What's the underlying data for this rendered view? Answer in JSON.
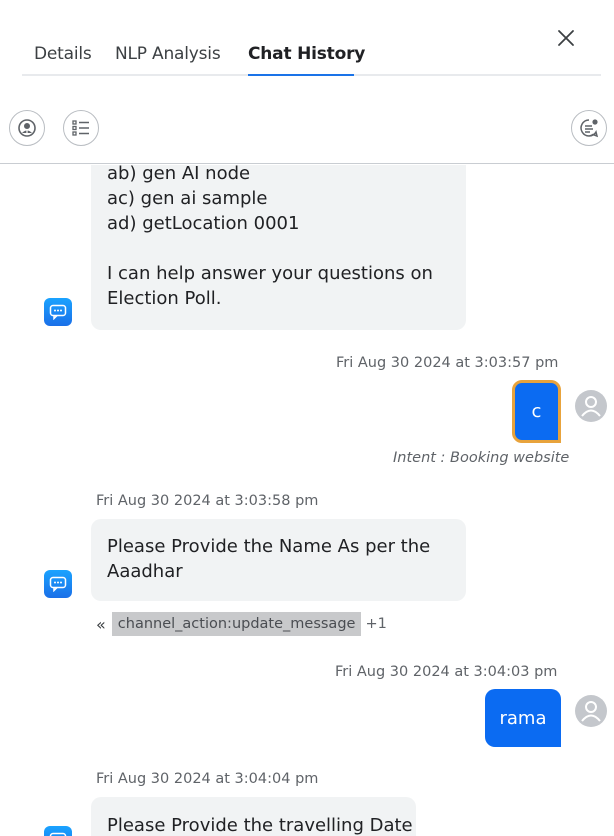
{
  "tabs": [
    {
      "label": "Details"
    },
    {
      "label": "NLP Analysis"
    },
    {
      "label": "Chat History"
    }
  ],
  "active_tab": "Chat History",
  "icons": {
    "close": "close-icon",
    "toolbar_left_1": "user-circle-icon",
    "toolbar_left_2": "list-icon",
    "toolbar_right": "chat-notification-icon",
    "bot": "bot-chat-icon",
    "user": "user-avatar-icon"
  },
  "colors": {
    "accent": "#1a73e8",
    "user_bubble": "#0b6bf2",
    "focus_outline": "#e8a33c",
    "bot_bubble": "#f1f3f4"
  },
  "messages": {
    "bot_1": {
      "lines": [
        "ab) gen AI node",
        "ac) gen ai sample",
        "ad) getLocation 0001",
        "",
        "I can help answer your questions on",
        "Election Poll."
      ]
    },
    "user_1": {
      "timestamp": "Fri Aug 30 2024 at 3:03:57 pm",
      "text": "c",
      "intent": "Intent : Booking website"
    },
    "bot_2": {
      "timestamp": "Fri Aug 30 2024 at 3:03:58 pm",
      "lines": [
        "Please Provide the Name As per the",
        "Aaadhar"
      ],
      "action_chip": "channel_action:update_message",
      "action_more": "+1",
      "action_chevron": "«"
    },
    "user_2": {
      "timestamp": "Fri Aug 30 2024 at 3:04:03 pm",
      "text": "rama"
    },
    "bot_3": {
      "timestamp": "Fri Aug 30 2024 at 3:04:04 pm",
      "lines": [
        "Please Provide the travelling Date"
      ]
    }
  }
}
